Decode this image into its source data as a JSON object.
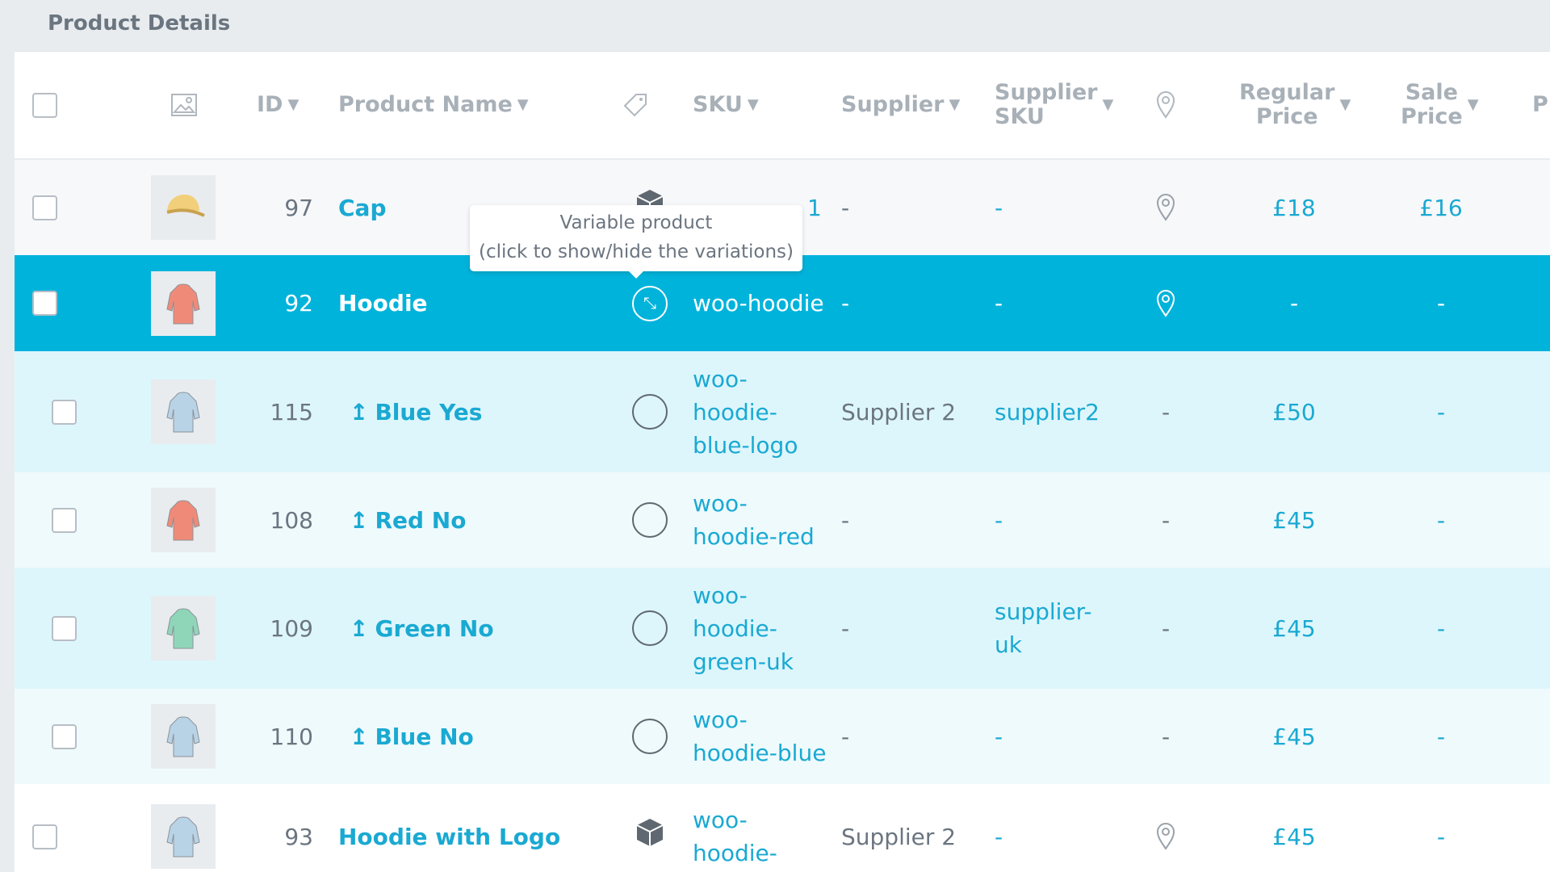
{
  "panel": {
    "title": "Product Details"
  },
  "colors": {
    "accent": "#00b3db",
    "link": "#1aa9d2",
    "variation_row_a": "#ddf6fc",
    "variation_row_b": "#effafd"
  },
  "columns": {
    "image_icon": "image-icon",
    "id": "ID",
    "name": "Product Name",
    "type_icon": "tag-icon",
    "sku": "SKU",
    "supplier": "Supplier",
    "supplier_sku_1": "Supplier",
    "supplier_sku_2": "SKU",
    "location_icon": "location-pin-icon",
    "regular_1": "Regular",
    "regular_2": "Price",
    "sale_1": "Sale",
    "sale_2": "Price",
    "next": "P"
  },
  "tooltip": {
    "line1": "Variable product",
    "line2": "(click to show/hide the variations)"
  },
  "rows": [
    {
      "id": "97",
      "name": "Cap",
      "type": "variable",
      "sku": "1",
      "supplier": "-",
      "supplier_sku": "-",
      "location": "pin",
      "regular": "£18",
      "sale": "£16"
    },
    {
      "id": "92",
      "name": "Hoodie",
      "type": "variable-expanded",
      "sku": "woo-hoodie",
      "supplier": "-",
      "supplier_sku": "-",
      "location": "pin",
      "regular": "-",
      "sale": "-"
    },
    {
      "id": "115",
      "name": "Blue Yes",
      "type": "variation",
      "sku": "woo-\nhoodie-\nblue-logo",
      "supplier": "Supplier 2",
      "supplier_sku": "supplier2",
      "location": "-",
      "regular": "£50",
      "sale": "-"
    },
    {
      "id": "108",
      "name": "Red No",
      "type": "variation",
      "sku": "woo-\nhoodie-red",
      "supplier": "-",
      "supplier_sku": "-",
      "location": "-",
      "regular": "£45",
      "sale": "-"
    },
    {
      "id": "109",
      "name": "Green No",
      "type": "variation",
      "sku": "woo-\nhoodie-\ngreen-uk",
      "supplier": "-",
      "supplier_sku": "supplier-\nuk",
      "location": "-",
      "regular": "£45",
      "sale": "-"
    },
    {
      "id": "110",
      "name": "Blue No",
      "type": "variation",
      "sku": "woo-\nhoodie-blue",
      "supplier": "-",
      "supplier_sku": "-",
      "location": "-",
      "regular": "£45",
      "sale": "-"
    },
    {
      "id": "93",
      "name": "Hoodie with Logo",
      "type": "simple",
      "sku": "woo-\nhoodie-",
      "supplier": "Supplier 2",
      "supplier_sku": "-",
      "location": "pin",
      "regular": "£45",
      "sale": "-"
    }
  ]
}
